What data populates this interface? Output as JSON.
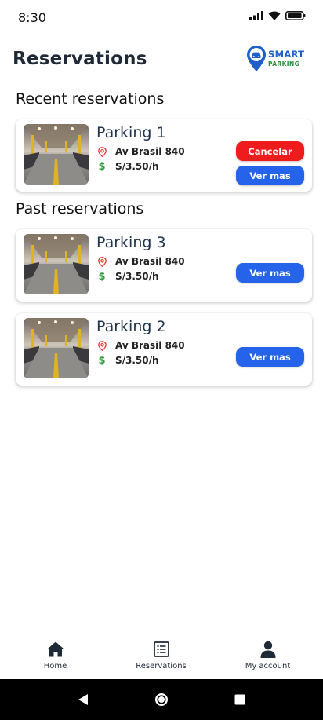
{
  "status_bar": {
    "time": "8:30"
  },
  "header": {
    "title": "Reservations",
    "logo_top": "SMART",
    "logo_bottom": "PARKING"
  },
  "sections": {
    "recent": "Recent reservations",
    "past": "Past reservations"
  },
  "recent_reservations": [
    {
      "name": "Parking 1",
      "address": "Av Brasil 840",
      "price": "S/3.50/h",
      "cancel_label": "Cancelar",
      "more_label": "Ver mas"
    }
  ],
  "past_reservations": [
    {
      "name": "Parking 3",
      "address": "Av Brasil 840",
      "price": "S/3.50/h",
      "more_label": "Ver mas"
    },
    {
      "name": "Parking 2",
      "address": "Av Brasil 840",
      "price": "S/3.50/h",
      "more_label": "Ver mas"
    }
  ],
  "bottom_nav": [
    {
      "label": "Home",
      "icon": "home-icon"
    },
    {
      "label": "Reservations",
      "icon": "list-icon"
    },
    {
      "label": "My account",
      "icon": "person-icon"
    }
  ],
  "colors": {
    "cancel": "#ee1c1c",
    "primary": "#2563eb",
    "title": "#1f3550",
    "location_pin": "#e53935",
    "price_icon": "#2e9e3f"
  }
}
